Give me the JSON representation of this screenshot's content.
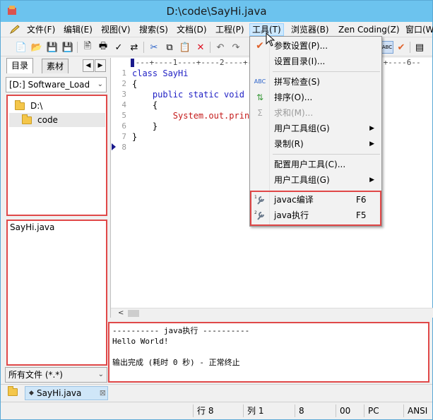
{
  "window": {
    "title": "D:\\code\\SayHi.java"
  },
  "menubar": {
    "items": [
      {
        "label": "文件(F)"
      },
      {
        "label": "编辑(E)"
      },
      {
        "label": "视图(V)"
      },
      {
        "label": "搜索(S)"
      },
      {
        "label": "文档(D)"
      },
      {
        "label": "工程(P)"
      },
      {
        "label": "工具(T)"
      },
      {
        "label": "浏览器(B)"
      },
      {
        "label": "Zen Coding(Z)"
      },
      {
        "label": "窗口(W)"
      }
    ],
    "active": "工具(T)"
  },
  "left_panel": {
    "tabs": [
      {
        "label": "目录"
      },
      {
        "label": "素材"
      }
    ],
    "drive": "[D:] Software_Load",
    "tree": [
      {
        "label": "D:\\"
      },
      {
        "label": "code"
      }
    ],
    "files": [
      {
        "label": "SayHi.java"
      }
    ],
    "filter": "所有文件 (*.*)"
  },
  "editor": {
    "ruler": "----+----1----+----2----+----3----+----4----+----5----+----6--",
    "lines": [
      {
        "num": "1",
        "code": "class SayHi"
      },
      {
        "num": "2",
        "code": "{"
      },
      {
        "num": "3",
        "code": "    public static void m"
      },
      {
        "num": "4",
        "code": "    {"
      },
      {
        "num": "5",
        "code": "        System.out.print"
      },
      {
        "num": "6",
        "code": "    }"
      },
      {
        "num": "7",
        "code": "}"
      },
      {
        "num": "8",
        "code": ""
      }
    ]
  },
  "output": {
    "lines": [
      "---------- java执行 ----------",
      "Hello World!",
      "",
      "输出完成 (耗时 0 秒) - 正常终止"
    ]
  },
  "doc_tab": {
    "label": "SayHi.java"
  },
  "status": {
    "line": "行 8",
    "col": "列 1",
    "pos": "8",
    "code": "00",
    "os": "PC",
    "encoding": "ANSI"
  },
  "tools_menu": {
    "items": [
      {
        "label": "参数设置(P)...",
        "icon": "checkmark-icon"
      },
      {
        "label": "设置目录(I)..."
      },
      {
        "label": "拼写检查(S)",
        "icon": "spellcheck-icon"
      },
      {
        "label": "排序(O)...",
        "icon": "sort-icon"
      },
      {
        "label": "求和(M)...",
        "icon": "sum-icon",
        "disabled": true
      },
      {
        "label": "用户工具组(G)",
        "submenu": true
      },
      {
        "label": "录制(R)",
        "submenu": true
      },
      {
        "label": "配置用户工具(C)..."
      },
      {
        "label": "用户工具组(G)",
        "submenu": true
      },
      {
        "label": "javac编译",
        "shortcut": "F6",
        "icon": "wrench-icon"
      },
      {
        "label": "java执行",
        "shortcut": "F5",
        "icon": "wrench-icon"
      }
    ]
  },
  "colors": {
    "titlebar": "#6cc3ee",
    "highlight": "#e04848",
    "keyword": "#1f1fc4",
    "system": "#c41a1a"
  }
}
